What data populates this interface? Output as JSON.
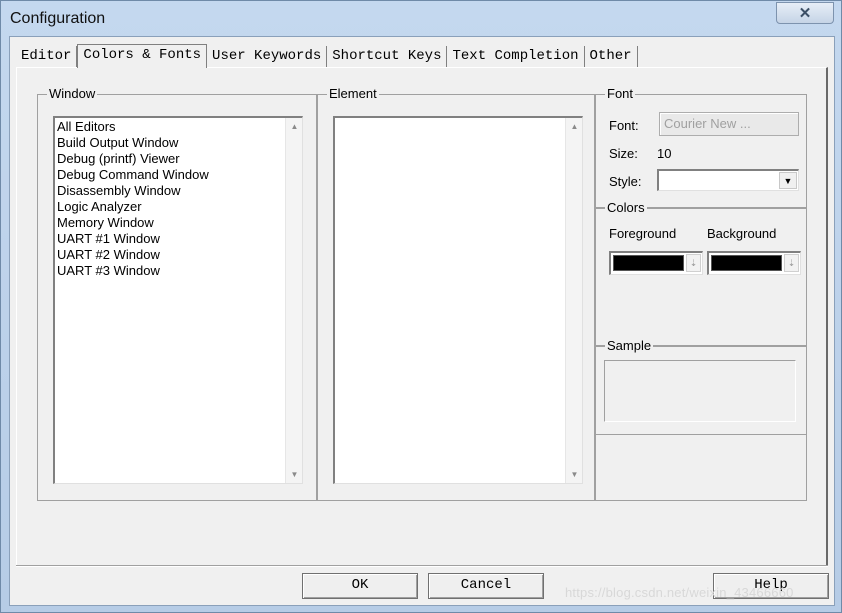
{
  "window": {
    "title": "Configuration",
    "close_glyph": "✕"
  },
  "tabs": [
    {
      "label": "Editor"
    },
    {
      "label": "Colors & Fonts",
      "active": true
    },
    {
      "label": "User Keywords"
    },
    {
      "label": "Shortcut Keys"
    },
    {
      "label": "Text Completion"
    },
    {
      "label": "Other"
    }
  ],
  "window_group": {
    "label": "Window",
    "items": [
      "All Editors",
      "Build Output Window",
      "Debug (printf) Viewer",
      "Debug Command Window",
      "Disassembly Window",
      "Logic Analyzer",
      "Memory Window",
      "UART #1 Window",
      "UART #2 Window",
      "UART #3 Window"
    ]
  },
  "element_group": {
    "label": "Element",
    "items": []
  },
  "font_group": {
    "label": "Font",
    "font_label": "Font:",
    "font_button": "Courier New ...",
    "size_label": "Size:",
    "size_value": "10",
    "style_label": "Style:",
    "style_value": ""
  },
  "colors_group": {
    "label": "Colors",
    "foreground_label": "Foreground",
    "background_label": "Background",
    "foreground_color": "#000000",
    "background_color": "#000000"
  },
  "sample_group": {
    "label": "Sample"
  },
  "buttons": {
    "ok": "OK",
    "cancel": "Cancel",
    "help": "Help"
  },
  "watermark": "https://blog.csdn.net/weixin_43466660"
}
